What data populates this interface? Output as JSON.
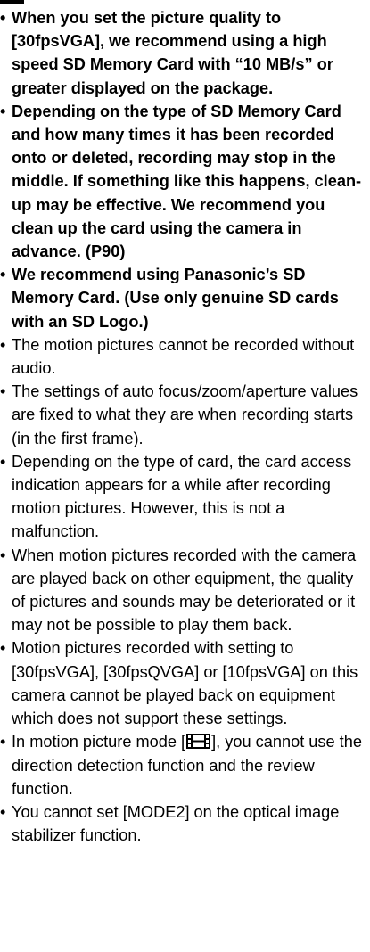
{
  "bullet_glyph": "•",
  "notes": [
    {
      "text": "When you set the picture quality to [30fpsVGA], we recommend using a high speed SD Memory Card with “10 MB/s” or greater displayed on the package."
    },
    {
      "text": "Depending on the type of SD Memory Card and how many times it has been recorded onto or deleted, recording may stop in the middle. If something like this happens, clean-up may be effective. We recommend you clean up the card using the camera in advance. (P90)"
    },
    {
      "text": "We recommend using Panasonic’s SD Memory Card. (Use only genuine SD cards with an SD Logo.)"
    },
    {
      "text": "The motion pictures cannot be recorded without audio."
    },
    {
      "text": "The settings of auto focus/zoom/aperture values are fixed to what they are when recording starts (in the first frame)."
    },
    {
      "text": "Depending on the type of card, the card access indication appears for a while after recording motion pictures. However, this is not a malfunction."
    },
    {
      "text": "When motion pictures recorded with the camera are played back on other equipment, the quality of pictures and sounds may be deteriorated or it may not be possible to play them back."
    },
    {
      "text": "Motion pictures recorded with setting to [30fpsVGA], [30fpsQVGA] or [10fpsVGA] on this camera cannot be played back on equipment which does not support these settings."
    },
    {
      "text_before": "In motion picture mode [",
      "icon": "motion-picture-icon",
      "text_after": "], you cannot use the direction detection function and the review function."
    },
    {
      "text": "You cannot set [MODE2] on the optical image stabilizer function."
    }
  ]
}
